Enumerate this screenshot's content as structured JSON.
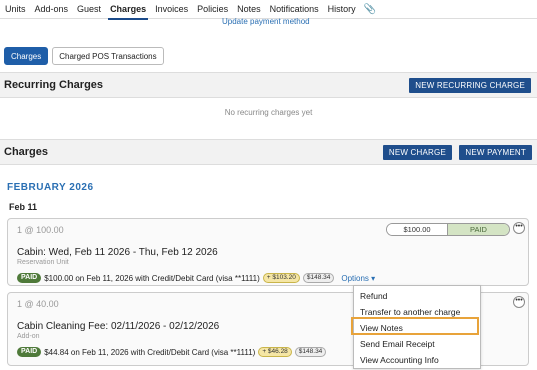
{
  "nav": {
    "tabs": [
      "Units",
      "Add-ons",
      "Guest",
      "Charges",
      "Invoices",
      "Policies",
      "Notes",
      "Notifications",
      "History"
    ],
    "active": "Charges"
  },
  "update_payment_link": "Update payment method",
  "subtabs": {
    "charges": "Charges",
    "pos": "Charged POS Transactions"
  },
  "recurring": {
    "title": "Recurring Charges",
    "new_button": "NEW RECURRING CHARGE",
    "empty": "No recurring charges yet"
  },
  "charges": {
    "title": "Charges",
    "new_charge": "NEW CHARGE",
    "new_payment": "NEW PAYMENT",
    "month": "FEBRUARY 2026",
    "date": "Feb 11",
    "items": [
      {
        "qty": "1 @ 100.00",
        "amount": "$100.00",
        "status": "PAID",
        "title": "Cabin: Wed, Feb 11 2026 - Thu, Feb 12 2026",
        "subtitle": "Reservation Unit",
        "paid_badge": "PAID",
        "payment": "$100.00 on Feb 11, 2026 with Credit/Debit Card (visa **1111)",
        "chip_plus": "+ $103.20",
        "chip_refund": "$148.34",
        "options": "Options ▾"
      },
      {
        "qty": "1 @ 40.00",
        "title": "Cabin Cleaning Fee: 02/11/2026 - 02/12/2026",
        "subtitle": "Add-on",
        "paid_badge": "PAID",
        "payment": "$44.84 on Feb 11, 2026 with Credit/Debit Card (visa **1111)",
        "chip_plus": "+ $46.28",
        "chip_refund": "$148.34"
      }
    ]
  },
  "options_menu": [
    "Refund",
    "Transfer to another charge",
    "View Notes",
    "Send Email Receipt",
    "View Accounting Info"
  ],
  "colors": {
    "primary": "#1f4e8c",
    "link": "#2a6fb3",
    "highlight": "#e8a33a",
    "paid": "#4f7a3a"
  }
}
